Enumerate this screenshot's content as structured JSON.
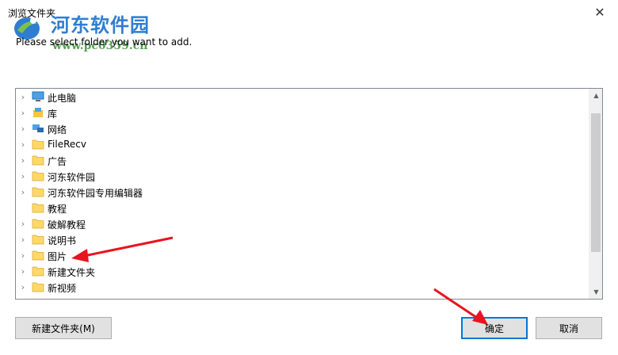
{
  "window": {
    "title": "浏览文件夹",
    "close_glyph": "✕"
  },
  "watermark": {
    "brand": "河东软件园",
    "url": "www.pc0359.cn"
  },
  "prompt": "Please select folder you want to add.",
  "tree": {
    "items": [
      {
        "label": "此电脑",
        "icon": "computer-icon",
        "expandable": true
      },
      {
        "label": "库",
        "icon": "library-icon",
        "expandable": true
      },
      {
        "label": "网络",
        "icon": "network-icon",
        "expandable": true
      },
      {
        "label": "FileRecv",
        "icon": "folder-icon",
        "expandable": true
      },
      {
        "label": "广告",
        "icon": "folder-icon",
        "expandable": true
      },
      {
        "label": "河东软件园",
        "icon": "folder-icon",
        "expandable": true
      },
      {
        "label": "河东软件园专用编辑器",
        "icon": "folder-icon",
        "expandable": true
      },
      {
        "label": "教程",
        "icon": "folder-icon",
        "expandable": false
      },
      {
        "label": "破解教程",
        "icon": "folder-icon",
        "expandable": true
      },
      {
        "label": "说明书",
        "icon": "folder-icon",
        "expandable": true
      },
      {
        "label": "图片",
        "icon": "folder-icon",
        "expandable": true
      },
      {
        "label": "新建文件夹",
        "icon": "folder-icon",
        "expandable": true
      },
      {
        "label": "新视频",
        "icon": "folder-icon",
        "expandable": true
      }
    ],
    "scroll_position": 0.25
  },
  "buttons": {
    "new_folder": "新建文件夹(M)",
    "ok": "确定",
    "cancel": "取消"
  },
  "colors": {
    "folder": "#ffd867",
    "accent": "#0078d7",
    "annotation": "#e8141e"
  }
}
